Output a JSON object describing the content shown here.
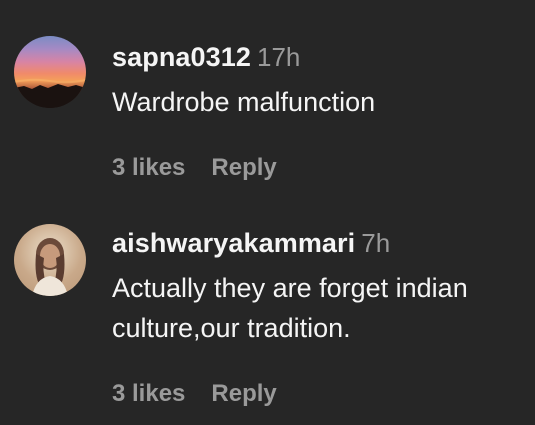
{
  "comments": [
    {
      "username": "sapna0312",
      "time": "17h",
      "text_lines": [
        "Wardrobe malfunction"
      ],
      "likes": "3 likes",
      "reply": "Reply",
      "avatar": "sunset-avatar"
    },
    {
      "username": "aishwaryakammari",
      "time": "7h",
      "text_lines": [
        "Actually they are forget indian",
        "culture,our tradition."
      ],
      "likes": "3 likes",
      "reply": "Reply",
      "avatar": "person-avatar"
    }
  ],
  "colors": {
    "background": "#262626",
    "primary_text": "#f5f5f5",
    "secondary_text": "#9a9a9a"
  }
}
